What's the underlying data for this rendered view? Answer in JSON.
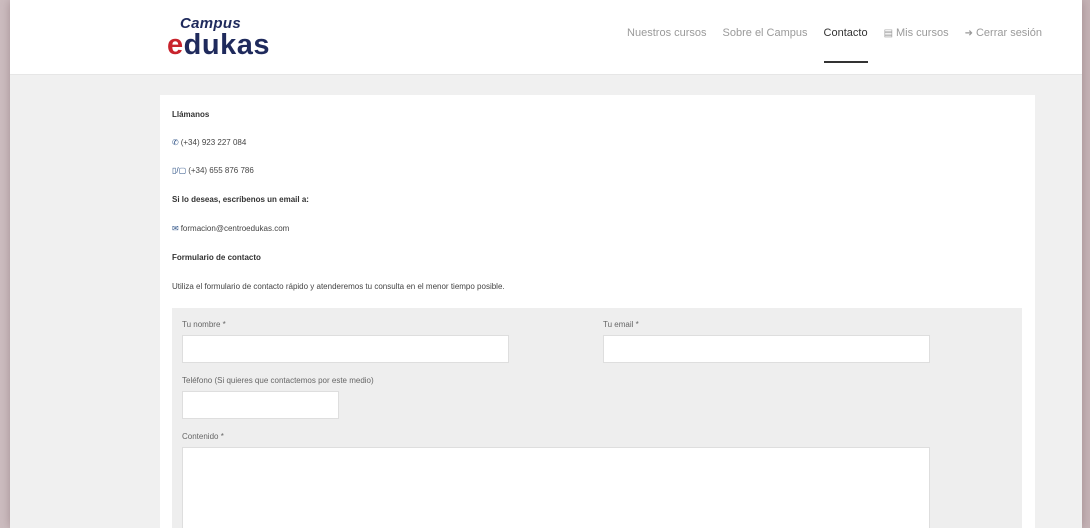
{
  "logo": {
    "top": "Campus",
    "bottom_part1": "e",
    "bottom_part2": "dukas"
  },
  "nav": {
    "items": [
      {
        "label": "Nuestros cursos"
      },
      {
        "label": "Sobre el Campus"
      },
      {
        "label": "Contacto"
      },
      {
        "label": "Mis cursos",
        "icon": "book-icon"
      },
      {
        "label": "Cerrar sesión",
        "icon": "sign-out-icon"
      }
    ],
    "active": "Contacto"
  },
  "contact": {
    "call_heading": "Llámanos",
    "phone": "(+34) 923 227 084",
    "mobile": "(+34) 655 876 786",
    "email_heading": "Si lo deseas, escríbenos un email a:",
    "email": "formacion@centroedukas.com",
    "form_heading": "Formulario de contacto",
    "form_intro": "Utiliza el formulario de contacto rápido y atenderemos tu consulta en el menor tiempo posible."
  },
  "form": {
    "name_label": "Tu nombre *",
    "email_label": "Tu email *",
    "phone_label": "Teléfono (Si quieres que contactemos por este medio)",
    "content_label": "Contenido *"
  }
}
